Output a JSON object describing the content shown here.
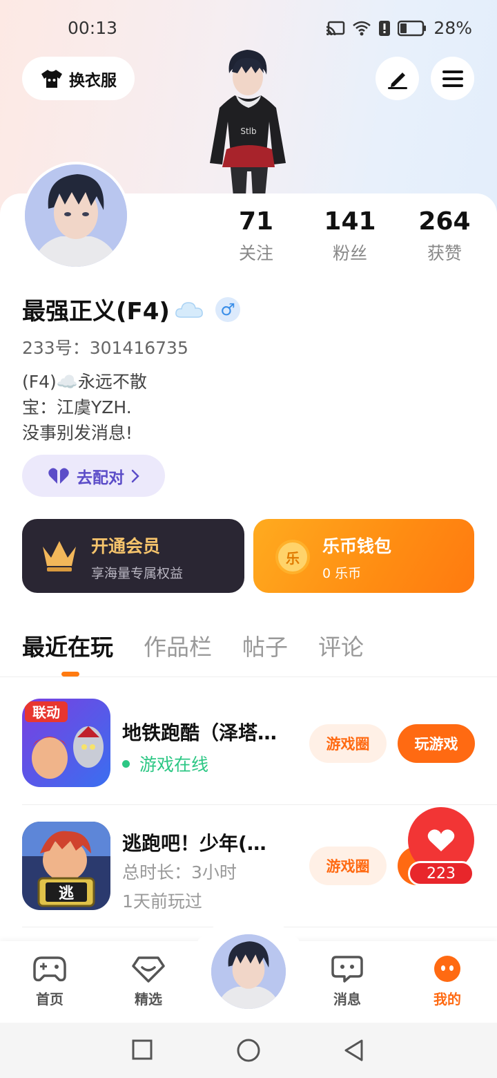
{
  "status_bar": {
    "time": "00:13",
    "battery": "28%"
  },
  "header": {
    "outfit_label": "换衣服",
    "edit_icon": "pencil-icon",
    "menu_icon": "hamburger-menu-icon"
  },
  "profile": {
    "stats": [
      {
        "value": "71",
        "label": "关注"
      },
      {
        "value": "141",
        "label": "粉丝"
      },
      {
        "value": "264",
        "label": "获赞"
      }
    ],
    "name": "最强正义(F4)",
    "gender_symbol": "♂",
    "uid": "233号：301416735",
    "bio_lines": [
      "(F4)☁️永远不散",
      "宝：江虞YZH.",
      "没事别发消息!"
    ],
    "match_label": "去配对"
  },
  "cards": {
    "vip": {
      "title": "开通会员",
      "subtitle": "享海量专属权益"
    },
    "wallet": {
      "title": "乐币钱包",
      "subtitle": "0 乐币",
      "coin_char": "乐"
    }
  },
  "tabs": [
    "最近在玩",
    "作品栏",
    "帖子",
    "评论"
  ],
  "games": [
    {
      "name": "地铁跑酷（泽塔…",
      "status": "游戏在线",
      "circle_label": "游戏圈",
      "play_label": "玩游戏",
      "icon_badge": "联动"
    },
    {
      "name": "逃跑吧！少年(…",
      "duration": "总时长：3小时",
      "last_played": "1天前玩过",
      "circle_label": "游戏圈",
      "icon_badge": "逃"
    }
  ],
  "like_float": {
    "count": "223"
  },
  "bottom_nav": [
    {
      "label": "首页",
      "icon": "gamepad-icon"
    },
    {
      "label": "精选",
      "icon": "heart-outline-icon"
    },
    {
      "label": "消息",
      "icon": "chat-bubble-icon"
    },
    {
      "label": "我的",
      "icon": "smiley-icon"
    }
  ],
  "colors": {
    "accent": "#ff6a12",
    "online": "#2cc784",
    "vip_bg": "#2a2633"
  }
}
